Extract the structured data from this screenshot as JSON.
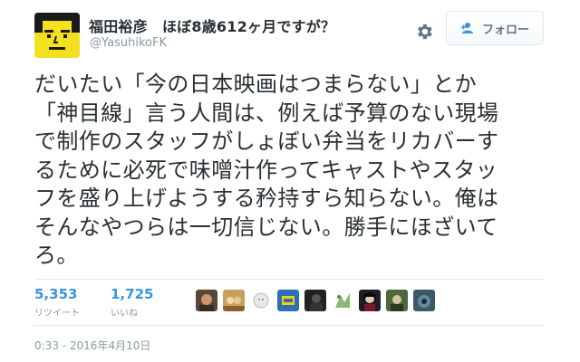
{
  "user": {
    "display_name": "福田裕彦　ほぼ8歳612ヶ月ですが？",
    "handle": "@YasuhikoFK",
    "avatar_icon": "yellow-face-avatar",
    "avatar_color": "#f5e020"
  },
  "actions": {
    "follow_label": "フォロー",
    "follow_icon": "follow-person-icon",
    "settings_icon": "gear-icon"
  },
  "tweet": {
    "lines": [
      "だいたい「今の日本映画はつまらない」とか",
      "「神目線」言う人間は、例えば予算のない現場",
      "で制作のスタッフがしょぼい弁当をリカバーす",
      "るために必死で味噌汁作ってキャストやスタッ",
      "フを盛り上げようする矜持すら知らない。俺は",
      "そんなやつらは一切信じない。勝手にほざいて",
      "ろ。"
    ]
  },
  "stats": {
    "retweets": "5,353",
    "retweets_label": "リツイート",
    "likes": "1,725",
    "likes_label": "いいね"
  },
  "likers": [
    {
      "icon": "liker-avatar-1",
      "color": "#5a4636"
    },
    {
      "icon": "liker-avatar-2",
      "color": "#c8a060"
    },
    {
      "icon": "liker-avatar-3",
      "color": "#e8e8e8"
    },
    {
      "icon": "liker-avatar-4",
      "color": "#2a6fb8"
    },
    {
      "icon": "liker-avatar-5",
      "color": "#222222"
    },
    {
      "icon": "liker-avatar-6",
      "color": "#d8e8d0"
    },
    {
      "icon": "liker-avatar-7",
      "color": "#1e1e28"
    },
    {
      "icon": "liker-avatar-8",
      "color": "#4a6a3a"
    },
    {
      "icon": "liker-avatar-9",
      "color": "#3a5a6a"
    }
  ],
  "timestamp": "0:33 - 2016年4月10日",
  "colors": {
    "link": "#3b94d9",
    "muted": "#8899a6",
    "text": "#292f33",
    "border": "#e1e8ed"
  }
}
